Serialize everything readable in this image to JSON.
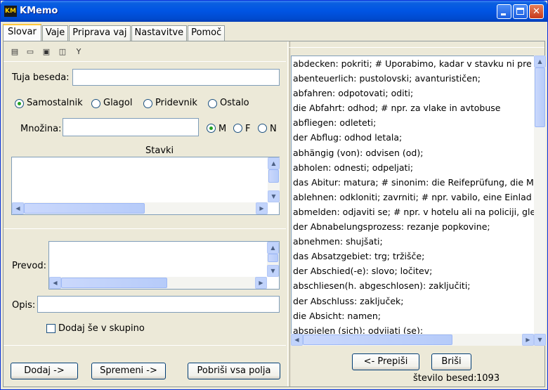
{
  "window": {
    "title": "KMemo",
    "icon_text": "KM"
  },
  "tabs": [
    "Slovar",
    "Vaje",
    "Priprava vaj",
    "Nastavitve",
    "Pomoč"
  ],
  "toolbar": {
    "icons": [
      "new-entry-icon",
      "open-icon",
      "save-icon",
      "save-all-icon",
      "filter-icon"
    ]
  },
  "form": {
    "foreign_word_label": "Tuja beseda:",
    "foreign_word_value": "",
    "word_types": {
      "noun": "Samostalnik",
      "verb": "Glagol",
      "adjective": "Pridevnik",
      "other": "Ostalo",
      "selected": "Samostalnik"
    },
    "plural_label": "Množina:",
    "plural_value": "",
    "genders": {
      "m": "M",
      "f": "F",
      "n": "N",
      "selected": "M"
    },
    "sentences_label": "Stavki",
    "translation_label": "Prevod:",
    "description_label": "Opis:",
    "add_to_group_label": "Dodaj še v skupino",
    "add_to_group_checked": false
  },
  "buttons": {
    "add": "Dodaj ->",
    "edit": "Spremeni ->",
    "clear": "Pobriši vsa polja",
    "copy": "<- Prepiši",
    "delete": "Briši"
  },
  "word_count": {
    "label": "število besed:",
    "value": "1093"
  },
  "word_list": [
    "abdecken:  pokriti;  # Uporabimo, kadar v stavku ni pre",
    "abenteuerlich:  pustolovski; avanturističen;",
    "abfahren:  odpotovati; oditi;",
    "die Abfahrt:  odhod;  # npr. za vlake in avtobuse",
    "abfliegen:  odleteti;",
    "der Abflug:  odhod letala;",
    "abhängig (von):  odvisen (od);",
    "abholen:  odnesti; odpeljati;",
    "das Abitur:  matura;  # sinonim: die Reifeprüfung, die M",
    "ablehnen:  odkloniti; zavrniti;  # npr. vabilo, eine Einlad",
    "abmelden:  odjaviti se;  # npr. v hotelu ali na policiji, gle",
    "der Abnabelungsprozess:  rezanje popkovine;",
    "abnehmen:  shujšati;",
    "das Absatzgebiet:  trg; tržišče;",
    "der Abschied(-e):  slovo; ločitev;",
    "abschliesen(h. abgeschlosen):  zaključiti;",
    "der Abschluss:  zaključek;",
    "die Absicht:  namen;",
    "abspielen (sich):  odvijati (se);"
  ]
}
